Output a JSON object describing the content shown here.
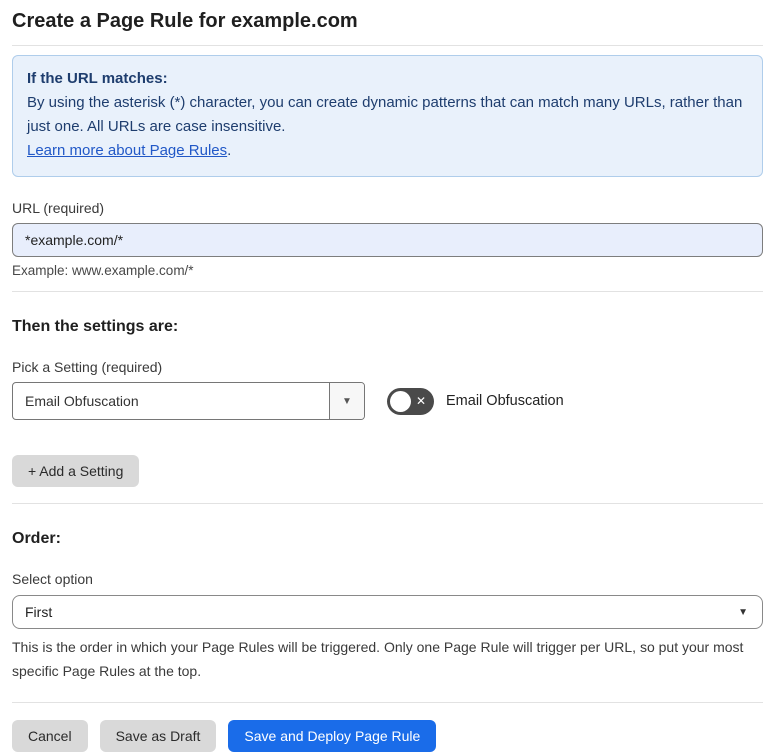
{
  "page": {
    "title": "Create a Page Rule for example.com"
  },
  "info_box": {
    "heading": "If the URL matches:",
    "body": "By using the asterisk (*) character, you can create dynamic patterns that can match many URLs, rather than just one. All URLs are case insensitive.",
    "link_label": "Learn more about Page Rules",
    "link_suffix": "."
  },
  "url_field": {
    "label": "URL (required)",
    "value": "*example.com/*",
    "example": "Example: www.example.com/*"
  },
  "settings_section": {
    "heading": "Then the settings are:",
    "pick_label": "Pick a Setting (required)",
    "selected_setting": "Email Obfuscation",
    "toggle_label": "Email Obfuscation",
    "toggle_state": "off",
    "add_button_label": "+ Add a Setting"
  },
  "order_section": {
    "heading": "Order:",
    "select_label": "Select option",
    "selected_option": "First",
    "description": "This is the order in which your Page Rules will be triggered. Only one Page Rule will trigger per URL, so put your most specific Page Rules at the top."
  },
  "footer": {
    "cancel_label": "Cancel",
    "save_draft_label": "Save as Draft",
    "save_deploy_label": "Save and Deploy Page Rule"
  },
  "icons": {
    "caret_down": "▼",
    "toggle_off_x": "✕"
  },
  "colors": {
    "accent_blue": "#1a6ce9",
    "info_background": "#e9f1fb",
    "info_border": "#afcdeb",
    "info_text": "#1e3d6e",
    "link_blue": "#2158c7",
    "url_input_background": "#e8eefc",
    "toggle_off_background": "#4a4a4a",
    "gray_button_background": "#d9d9d9"
  }
}
